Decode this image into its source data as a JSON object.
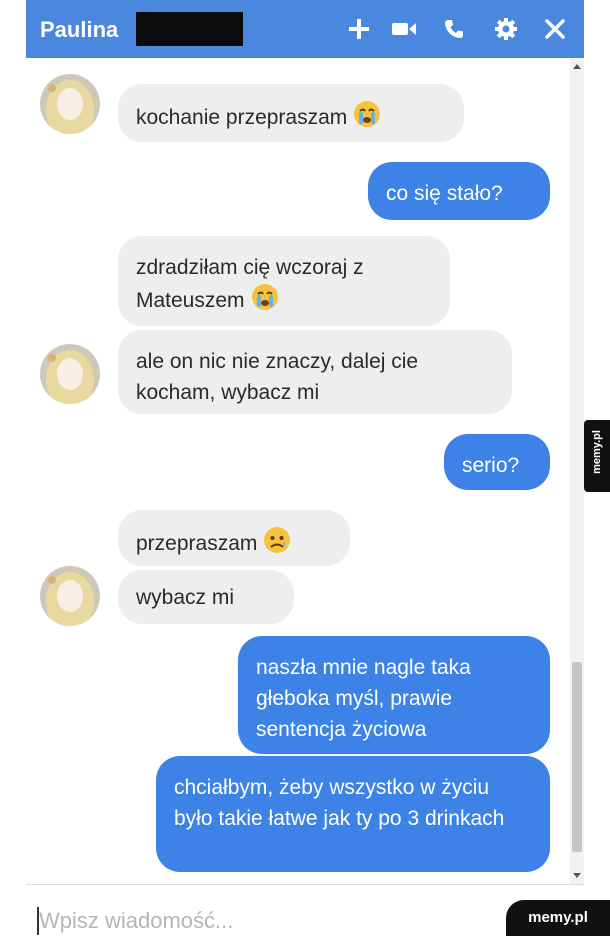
{
  "header": {
    "contact_name": "Paulina",
    "actions": [
      {
        "icon": "plus-icon"
      },
      {
        "icon": "video-camera-icon"
      },
      {
        "icon": "phone-icon"
      },
      {
        "icon": "gear-icon"
      },
      {
        "icon": "close-icon"
      }
    ],
    "background_color": "#4a88e0"
  },
  "messages": [
    {
      "from": "contact",
      "text": "kochanie przepraszam",
      "emoji": "crying-face-icon"
    },
    {
      "from": "me",
      "text": "co się stało?"
    },
    {
      "from": "contact",
      "text": "zdradziłam cię wczoraj z Mateuszem",
      "emoji": "crying-face-icon"
    },
    {
      "from": "contact",
      "text": "ale on nic nie znaczy, dalej cie kocham, wybacz mi"
    },
    {
      "from": "me",
      "text": "serio?"
    },
    {
      "from": "contact",
      "text": "przepraszam",
      "emoji": "sad-face-icon"
    },
    {
      "from": "contact",
      "text": "wybacz mi"
    },
    {
      "from": "me",
      "text": "naszła mnie nagle taka głeboka myśl, prawie sentencja życiowa"
    },
    {
      "from": "me",
      "text": "chciałbym, żeby wszystko w życiu było takie łatwe jak ty po 3 drinkach"
    }
  ],
  "composer": {
    "placeholder": "Wpisz wiadomość..."
  },
  "watermarks": {
    "side": "memy.pl",
    "corner": "memy.pl"
  },
  "colors": {
    "outgoing_bubble": "#3d82e6",
    "incoming_bubble": "#eeeeee"
  }
}
